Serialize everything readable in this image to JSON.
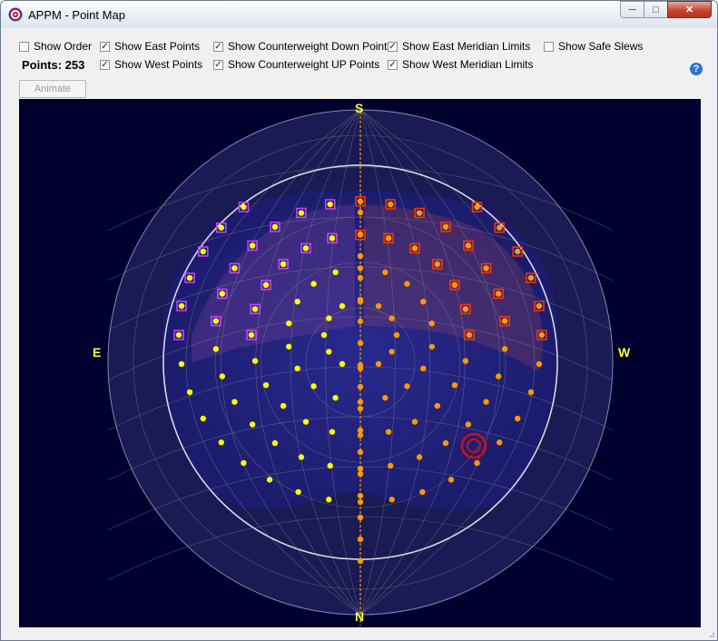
{
  "window": {
    "title": "APPM - Point Map"
  },
  "controls": {
    "show_order": {
      "label": "Show Order",
      "checked": false
    },
    "show_east": {
      "label": "Show East Points",
      "checked": true
    },
    "show_west": {
      "label": "Show West Points",
      "checked": true
    },
    "show_cw_down": {
      "label": "Show Counterweight Down Points",
      "checked": true
    },
    "show_cw_up": {
      "label": "Show Counterweight UP Points",
      "checked": true
    },
    "show_east_limits": {
      "label": "Show East Meridian Limits",
      "checked": true
    },
    "show_west_limits": {
      "label": "Show West Meridian Limits",
      "checked": true
    },
    "show_safe_slews": {
      "label": "Show Safe Slews",
      "checked": false
    }
  },
  "points_label": "Points: 253",
  "animate_label": "Animate",
  "help_icon": "?",
  "compass": {
    "south": "S",
    "north": "N",
    "east": "E",
    "west": "W"
  },
  "colors": {
    "background": "#000030",
    "east_point": "#ffff00",
    "west_point": "#ff9900",
    "cw_up_marker": "#cc44ff",
    "cw_up_marker_west": "#ff3300",
    "meridian": "#ff9900",
    "current_position": "#cc1111"
  },
  "icons": {
    "app": "app-target-icon",
    "minimize": "minimize-icon",
    "maximize": "maximize-icon",
    "close": "close-icon",
    "help": "help-icon",
    "resize": "resize-grip-icon"
  }
}
